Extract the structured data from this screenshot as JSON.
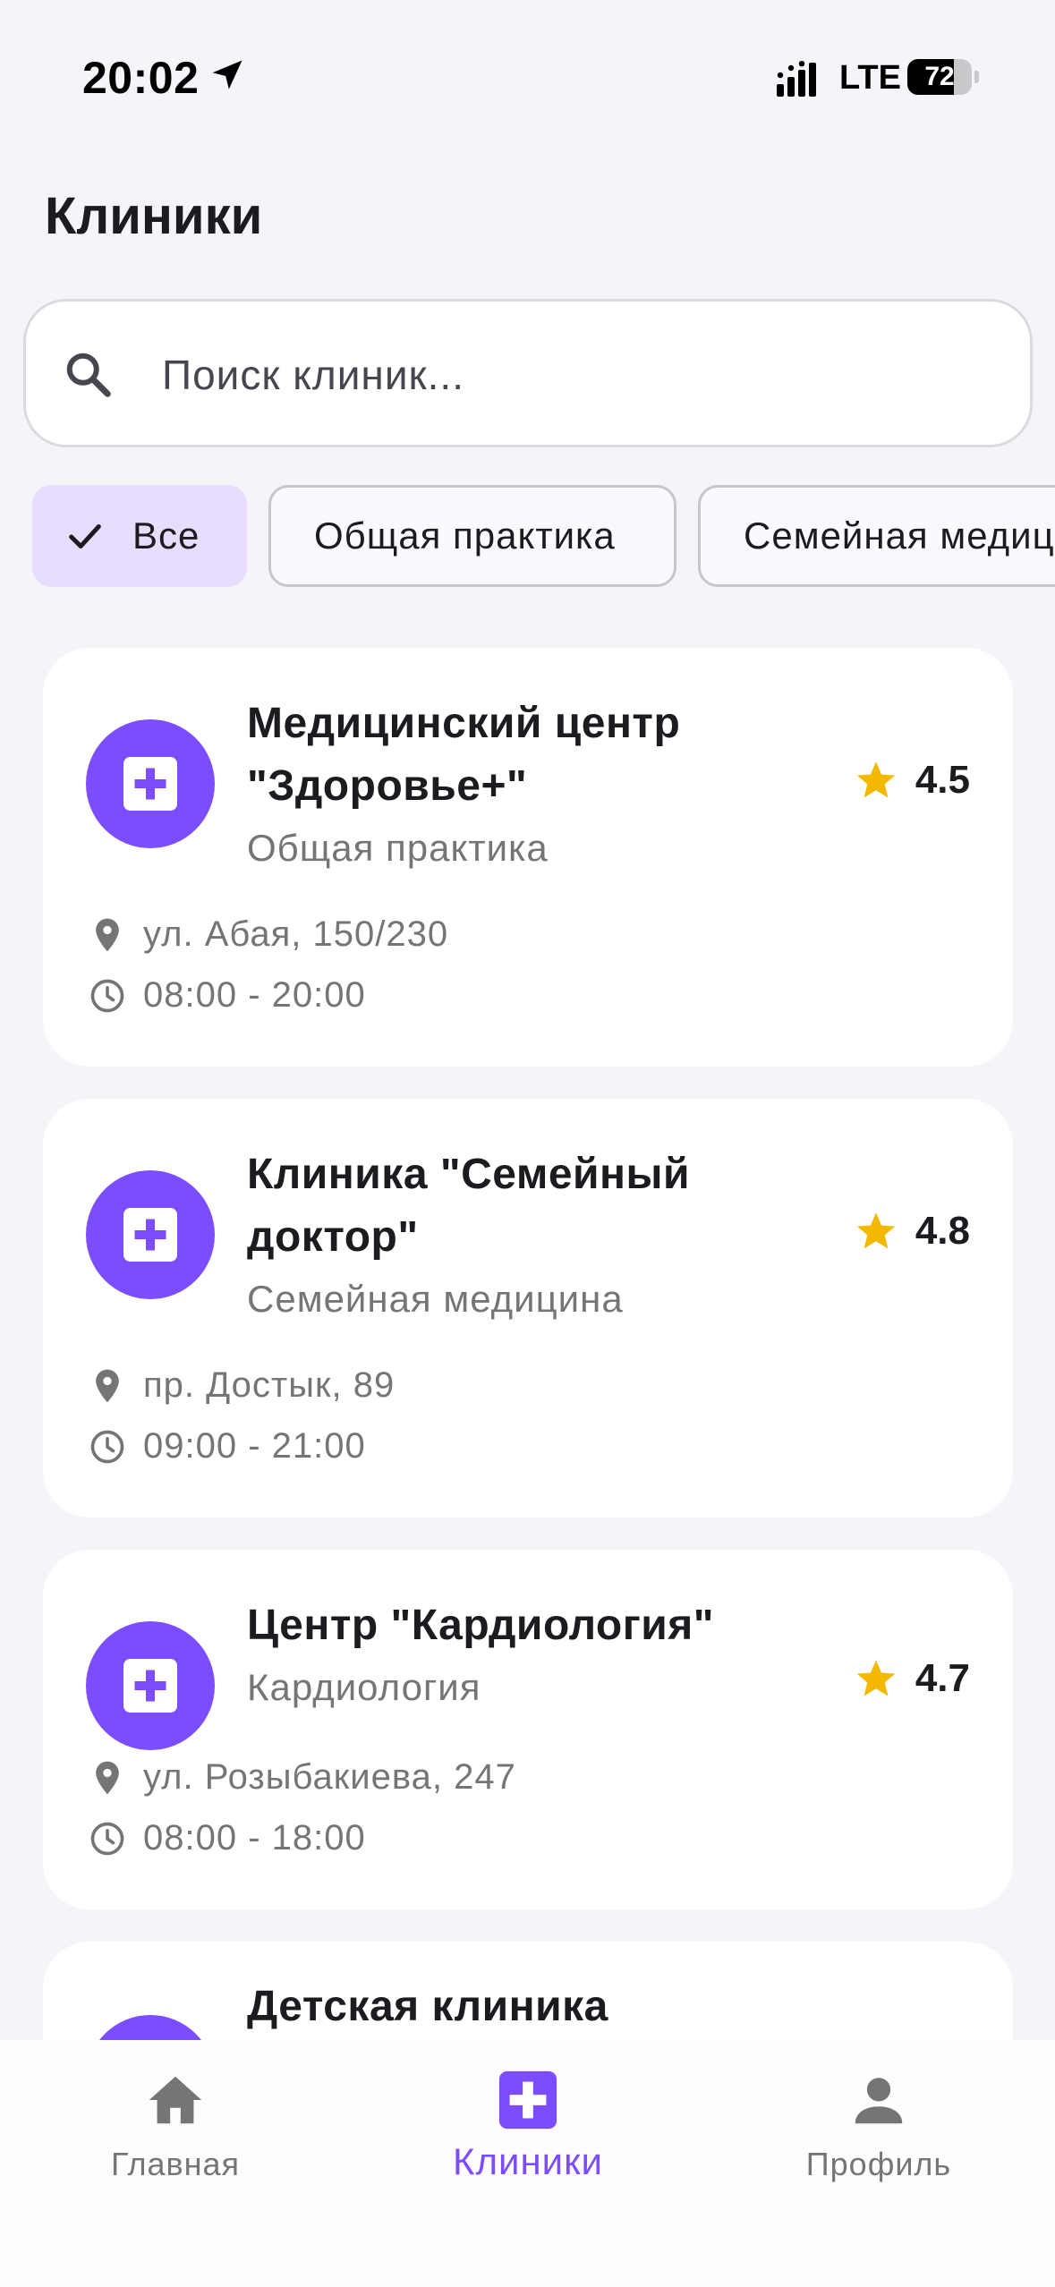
{
  "status_bar": {
    "time": "20:02",
    "network": "LTE",
    "battery": "72",
    "battery_level": 0.72
  },
  "header": {
    "title": "Клиники"
  },
  "search": {
    "placeholder": "Поиск клиник..."
  },
  "filters": [
    {
      "label": "Все",
      "selected": true
    },
    {
      "label": "Общая практика",
      "selected": false
    },
    {
      "label": "Семейная медицина",
      "selected": false
    }
  ],
  "clinics": [
    {
      "name": "Медицинский центр \"Здоровье+\"",
      "type": "Общая практика",
      "rating": "4.5",
      "address": "ул. Абая, 150/230",
      "hours": "08:00 - 20:00"
    },
    {
      "name": "Клиника \"Семейный доктор\"",
      "type": "Семейная медицина",
      "rating": "4.8",
      "address": "пр. Достык, 89",
      "hours": "09:00 - 21:00"
    },
    {
      "name": "Центр \"Кардиология\"",
      "type": "Кардиология",
      "rating": "4.7",
      "address": "ул. Розыбакиева, 247",
      "hours": "08:00 - 18:00"
    },
    {
      "name": "Детская клиника"
    }
  ],
  "bottom_nav": {
    "items": [
      {
        "label": "Главная",
        "icon": "home-icon",
        "active": false
      },
      {
        "label": "Клиники",
        "icon": "medical-cross-icon",
        "active": true
      },
      {
        "label": "Профиль",
        "icon": "person-icon",
        "active": false
      }
    ]
  },
  "colors": {
    "accent": "#7c4dff",
    "chip_selected": "#e9ddff",
    "star": "#f5b800",
    "background": "#f4f4f9"
  }
}
